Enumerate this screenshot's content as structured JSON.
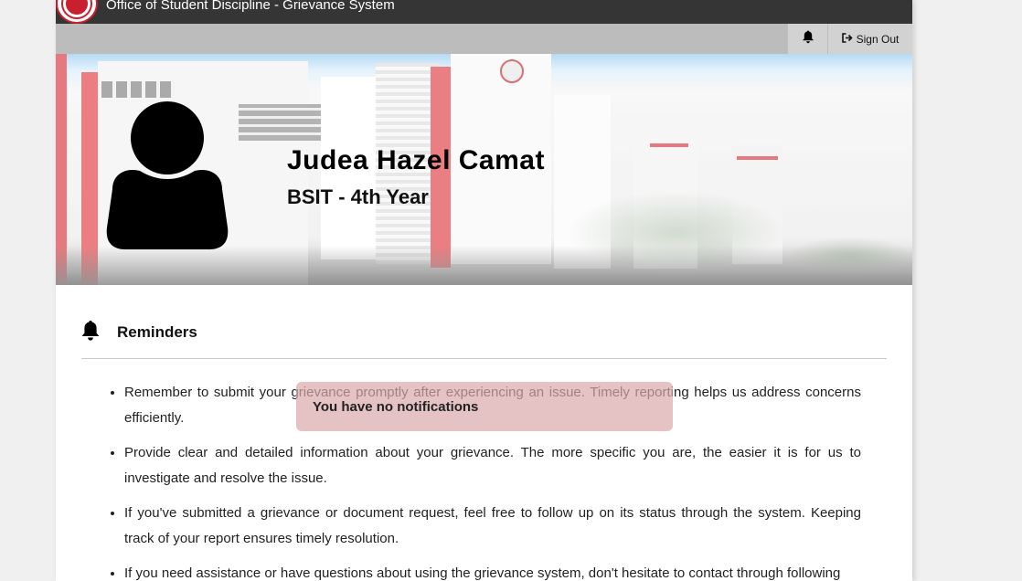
{
  "header": {
    "app_title": "Office of Student Discipline - Grievance System",
    "logo": "university-seal"
  },
  "navbar": {
    "notification_icon": "bell-icon",
    "sign_out_icon": "sign-out-icon",
    "sign_out_label": "Sign Out"
  },
  "profile": {
    "name": "Judea Hazel Camat",
    "course": "BSIT - 4th Year",
    "avatar_icon": "user-silhouette-icon"
  },
  "reminders": {
    "icon": "bell-icon",
    "title": "Reminders",
    "items": [
      "Remember to submit your grievance promptly after experiencing an issue. Timely reporting helps us address concerns efficiently.",
      "Provide clear and detailed information about your grievance. The more specific you are, the easier it is for us to investigate and resolve the issue.",
      "If you've submitted a grievance or document request, feel free to follow up on its status through the system. Keeping track of your report ensures timely resolution.",
      "If you need assistance or have questions about using the grievance system, don't hesitate to contact through following"
    ]
  },
  "toast": {
    "message": "You have no notifications"
  },
  "colors": {
    "titlebar": "#353535",
    "navbar": "#bcbcbc",
    "accent_red": "#c8202f",
    "toast_bg": "#daaaad"
  }
}
